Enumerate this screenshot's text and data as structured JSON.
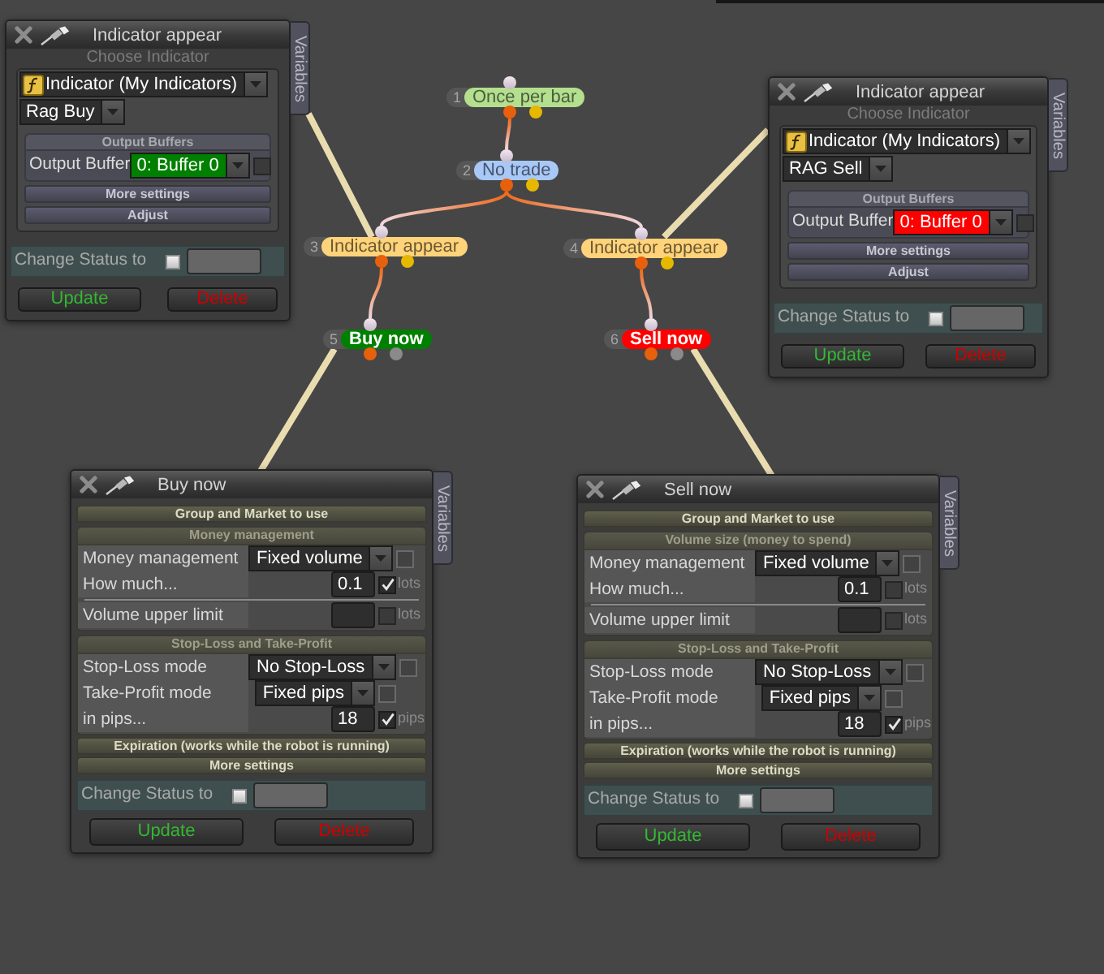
{
  "nodes": [
    {
      "number": "1",
      "label": "Once per bar",
      "kind": "condition",
      "color": "#b3df8e"
    },
    {
      "number": "2",
      "label": "No trade",
      "kind": "condition",
      "color": "#a8c8f8"
    },
    {
      "number": "3",
      "label": "Indicator appear",
      "kind": "condition",
      "color": "#ffd37a"
    },
    {
      "number": "4",
      "label": "Indicator appear",
      "kind": "condition",
      "color": "#ffd37a"
    },
    {
      "number": "5",
      "label": "Buy now",
      "kind": "action",
      "color": "#008000"
    },
    {
      "number": "6",
      "label": "Sell now",
      "kind": "action",
      "color": "#ff0000"
    }
  ],
  "windows": [
    {
      "kind": "indicator",
      "title": "Indicator appear",
      "tab": "Variables",
      "prompt": "Choose Indicator",
      "indicator": "Indicator (My Indicators)",
      "name": "Rag Buy",
      "output_buffers": {
        "heading": "Output Buffers",
        "label": "Output Buffer",
        "value": "0: Buffer 0",
        "color": "#008000",
        "checked": false
      },
      "bars": [
        "More settings",
        "Adjust"
      ],
      "change_status": {
        "label": "Change Status to",
        "checked": false
      },
      "buttons": [
        {
          "label": "Update",
          "kind": "update"
        },
        {
          "label": "Delete",
          "kind": "delete"
        }
      ]
    },
    {
      "kind": "indicator",
      "title": "Indicator appear",
      "tab": "Variables",
      "prompt": "Choose Indicator",
      "indicator": "Indicator (My Indicators)",
      "name": "RAG Sell",
      "output_buffers": {
        "heading": "Output Buffers",
        "label": "Output Buffer",
        "value": "0: Buffer 0",
        "color": "#ff0000",
        "checked": false
      },
      "bars": [
        "More settings",
        "Adjust"
      ],
      "change_status": {
        "label": "Change Status to",
        "checked": false
      },
      "buttons": [
        {
          "label": "Update",
          "kind": "update"
        },
        {
          "label": "Delete",
          "kind": "delete"
        }
      ]
    },
    {
      "kind": "trade",
      "title": "Buy now",
      "tab": "Variables",
      "sections": [
        {
          "kind": "bar",
          "label": "Group and Market to use"
        },
        {
          "kind": "group",
          "heading": "Money management",
          "rows": [
            {
              "kind": "dropdown",
              "label": "Money management",
              "value": "Fixed volume",
              "checked": false,
              "disabled": true
            },
            {
              "kind": "number",
              "label": "How much...",
              "value": "0.1",
              "checked": true,
              "disabled": false,
              "unit": "lots"
            },
            {
              "kind": "divider"
            },
            {
              "kind": "number",
              "label": "Volume upper limit",
              "checked": false,
              "disabled": false,
              "unit": "lots"
            }
          ]
        },
        {
          "kind": "group",
          "heading": "Stop-Loss and Take-Profit",
          "rows": [
            {
              "kind": "dropdown",
              "label": "Stop-Loss mode",
              "value": "No Stop-Loss",
              "checked": false,
              "disabled": true
            },
            {
              "kind": "dropdown",
              "label": "Take-Profit mode",
              "value": "Fixed pips",
              "checked": false,
              "disabled": true
            },
            {
              "kind": "number",
              "label": "in pips...",
              "value": "18",
              "checked": true,
              "disabled": false,
              "unit": "pips"
            }
          ]
        },
        {
          "kind": "bar",
          "label": "Expiration (works while the robot is running)"
        },
        {
          "kind": "bar",
          "label": "More settings"
        }
      ],
      "change_status": {
        "label": "Change Status to",
        "checked": false
      },
      "buttons": [
        {
          "label": "Update",
          "kind": "update"
        },
        {
          "label": "Delete",
          "kind": "delete"
        }
      ]
    },
    {
      "kind": "trade",
      "title": "Sell now",
      "tab": "Variables",
      "sections": [
        {
          "kind": "bar",
          "label": "Group and Market to use"
        },
        {
          "kind": "group",
          "heading": "Volume size (money to spend)",
          "rows": [
            {
              "kind": "dropdown",
              "label": "Money management",
              "value": "Fixed volume",
              "checked": false,
              "disabled": true
            },
            {
              "kind": "number",
              "label": "How much...",
              "value": "0.1",
              "checked": false,
              "disabled": false,
              "unit": "lots"
            },
            {
              "kind": "divider"
            },
            {
              "kind": "number",
              "label": "Volume upper limit",
              "checked": false,
              "disabled": false,
              "unit": "lots"
            }
          ]
        },
        {
          "kind": "group",
          "heading": "Stop-Loss and Take-Profit",
          "rows": [
            {
              "kind": "dropdown",
              "label": "Stop-Loss mode",
              "value": "No Stop-Loss",
              "checked": false,
              "disabled": true
            },
            {
              "kind": "dropdown",
              "label": "Take-Profit mode",
              "value": "Fixed pips",
              "checked": false,
              "disabled": true
            },
            {
              "kind": "number",
              "label": "in pips...",
              "value": "18",
              "checked": true,
              "disabled": false,
              "unit": "pips"
            }
          ]
        },
        {
          "kind": "bar",
          "label": "Expiration (works while the robot is running)"
        },
        {
          "kind": "bar",
          "label": "More settings"
        }
      ],
      "change_status": {
        "label": "Change Status to",
        "checked": false
      },
      "buttons": [
        {
          "label": "Update",
          "kind": "update"
        },
        {
          "label": "Delete",
          "kind": "delete"
        }
      ]
    }
  ]
}
